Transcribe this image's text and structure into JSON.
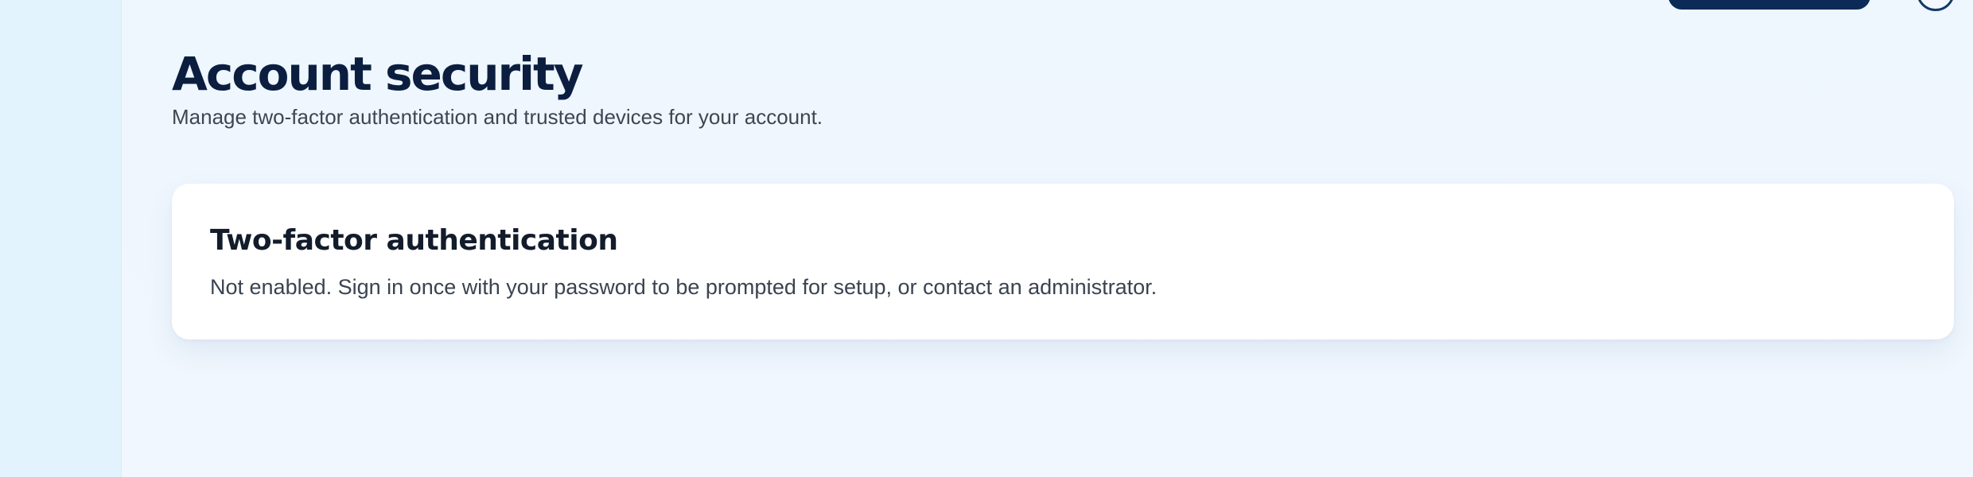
{
  "colors": {
    "sidebar": "#e3f3fd",
    "page_background": "#f0f7fe",
    "primary_button": "#0b2a57",
    "title_text": "#0b1e3f",
    "body_text": "#3d4653",
    "card_background": "#ffffff"
  },
  "header": {
    "title": "Account security",
    "subtitle": "Manage two-factor authentication and trusted devices for your account."
  },
  "two_factor_card": {
    "title": "Two-factor authentication",
    "description": "Not enabled. Sign in once with your password to be prompted for setup, or contact an administrator."
  },
  "icons": {
    "avatar": "user-avatar-icon"
  }
}
